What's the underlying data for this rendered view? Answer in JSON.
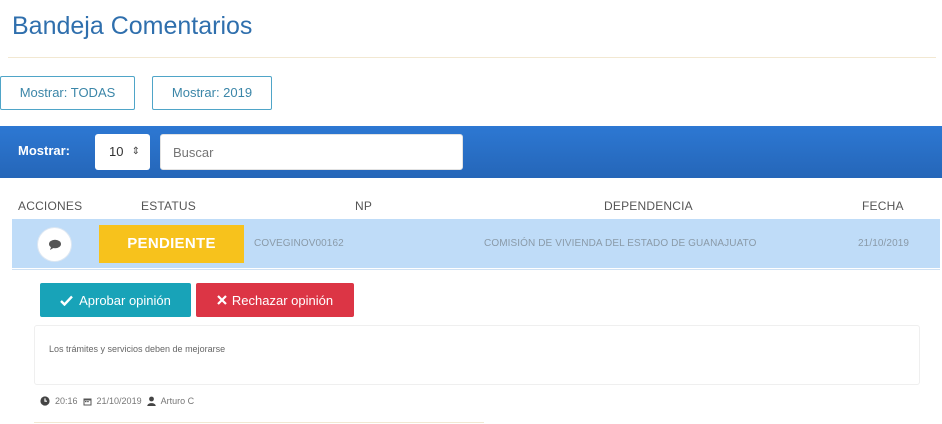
{
  "page": {
    "title": "Bandeja Comentarios"
  },
  "filters": [
    {
      "label": "Mostrar: TODAS"
    },
    {
      "label": "Mostrar: 2019"
    }
  ],
  "toolbar": {
    "show_label": "Mostrar:",
    "page_size": "10",
    "search_placeholder": "Buscar"
  },
  "table": {
    "headers": [
      "ACCIONES",
      "ESTATUS",
      "NP",
      "DEPENDENCIA",
      "FECHA"
    ],
    "rows": [
      {
        "status": "PENDIENTE",
        "np": "COVEGINOV00162",
        "dependencia": "COMISIÓN DE VIVIENDA DEL ESTADO DE GUANAJUATO",
        "fecha": "21/10/2019"
      }
    ]
  },
  "actions": {
    "approve_label": "Aprobar opinión",
    "reject_label": "Rechazar opinión"
  },
  "comment": {
    "text": "Los trámites y servicios deben de mejorarse",
    "time": "20:16",
    "date": "21/10/2019",
    "author": "Arturo C"
  },
  "colors": {
    "title": "#2f6fad",
    "toolbar": "#2d78d3",
    "row_highlight": "#bfdcf8",
    "badge_pending": "#f7c21c",
    "approve": "#18a3b8",
    "reject": "#dc3545"
  }
}
